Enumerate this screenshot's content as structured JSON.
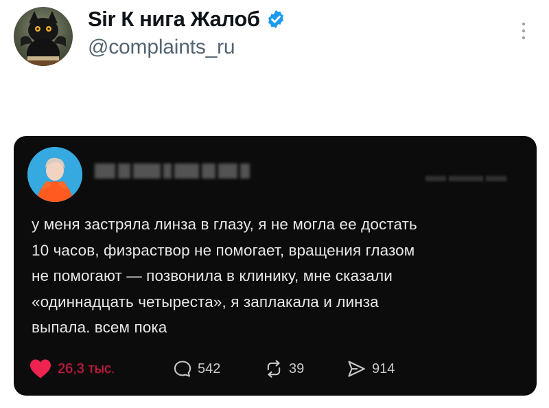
{
  "tweet": {
    "author_name": "Sir К нига Жалоб",
    "author_handle": "@complaints_ru",
    "verified": true
  },
  "embedded_post": {
    "lines": [
      "у меня застряла линза в глазу, я не могла ее достать",
      "10 часов, физраствор не помогает, вращения глазом",
      "не помогают — позвонила в клинику, мне сказали",
      "«одиннадцать четыреста», я заплакала и линза",
      "выпала. всем пока"
    ],
    "stats": {
      "likes": "26,3 тыс.",
      "replies": "542",
      "reposts": "39",
      "shares": "914"
    }
  },
  "icons": {
    "verified": "verified-badge-icon",
    "more": "more-vertical-icon",
    "like": "heart-icon",
    "reply": "speech-bubble-icon",
    "repost": "repost-icon",
    "share": "send-icon"
  },
  "colors": {
    "verified_blue": "#1d9bf0",
    "like_red": "#f0224f",
    "card_bg": "#0c0c0c",
    "handle_gray": "#536471"
  }
}
